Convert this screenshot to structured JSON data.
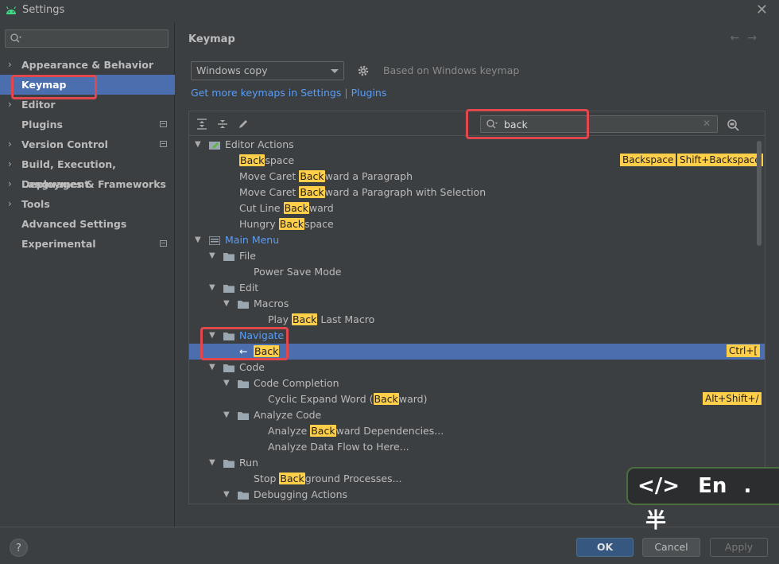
{
  "window": {
    "title": "Settings"
  },
  "sidebar": {
    "search_placeholder": "",
    "items": [
      {
        "label": "Appearance & Behavior",
        "expandable": true
      },
      {
        "label": "Keymap",
        "selected": true
      },
      {
        "label": "Editor",
        "expandable": true
      },
      {
        "label": "Plugins",
        "project_icon": true
      },
      {
        "label": "Version Control",
        "expandable": true,
        "project_icon": true
      },
      {
        "label": "Build, Execution, Deployment",
        "expandable": true
      },
      {
        "label": "Languages & Frameworks",
        "expandable": true
      },
      {
        "label": "Tools",
        "expandable": true
      },
      {
        "label": "Advanced Settings"
      },
      {
        "label": "Experimental",
        "project_icon": true
      }
    ]
  },
  "main": {
    "heading": "Keymap",
    "keymap_select": "Windows copy",
    "based_on": "Based on Windows keymap",
    "get_more_link": "Get more keymaps in Settings",
    "link_separator": "|",
    "plugins_link": "Plugins",
    "search_value": "back"
  },
  "tree": [
    {
      "pre": "",
      "hl": "",
      "post": "Editor Actions"
    },
    {
      "pre": "",
      "hl": "Back",
      "post": "space",
      "shortcuts": [
        "Backspace",
        "Shift+Backspace"
      ]
    },
    {
      "pre": "Move Caret ",
      "hl": "Back",
      "post": "ward a Paragraph"
    },
    {
      "pre": "Move Caret ",
      "hl": "Back",
      "post": "ward a Paragraph with Selection"
    },
    {
      "pre": "Cut Line ",
      "hl": "Back",
      "post": "ward"
    },
    {
      "pre": "Hungry ",
      "hl": "Back",
      "post": "space"
    },
    {
      "pre": "",
      "hl": "",
      "post": "Main Menu"
    },
    {
      "pre": "",
      "hl": "",
      "post": "File"
    },
    {
      "pre": "",
      "hl": "",
      "post": "Power Save Mode"
    },
    {
      "pre": "",
      "hl": "",
      "post": "Edit"
    },
    {
      "pre": "",
      "hl": "",
      "post": "Macros"
    },
    {
      "pre": "Play ",
      "hl": "Back",
      "post": " Last Macro"
    },
    {
      "pre": "",
      "hl": "",
      "post": "Navigate"
    },
    {
      "pre": "",
      "hl": "Back",
      "post": "",
      "shortcuts": [
        "Ctrl+["
      ]
    },
    {
      "pre": "",
      "hl": "",
      "post": "Code"
    },
    {
      "pre": "",
      "hl": "",
      "post": "Code Completion"
    },
    {
      "pre": "Cyclic Expand Word (",
      "hl": "Back",
      "post": "ward)",
      "shortcuts": [
        "Alt+Shift+/"
      ]
    },
    {
      "pre": "",
      "hl": "",
      "post": "Analyze Code"
    },
    {
      "pre": "Analyze ",
      "hl": "Back",
      "post": "ward Dependencies..."
    },
    {
      "pre": "",
      "hl": "",
      "post": "Analyze Data Flow to Here..."
    },
    {
      "pre": "",
      "hl": "",
      "post": "Run"
    },
    {
      "pre": "Stop ",
      "hl": "Back",
      "post": "ground Processes..."
    },
    {
      "pre": "",
      "hl": "",
      "post": "Debugging Actions"
    }
  ],
  "footer": {
    "help": "?",
    "ok": "OK",
    "cancel": "Cancel",
    "apply": "Apply"
  },
  "ime_indicator": {
    "code_glyph": "</>",
    "lang": "En",
    "dot": ".",
    "width": "半"
  },
  "colors": {
    "selection": "#4b6eaf",
    "highlight": "#ffcf4a",
    "link": "#589df6",
    "annotation_box": "#e0484e"
  }
}
